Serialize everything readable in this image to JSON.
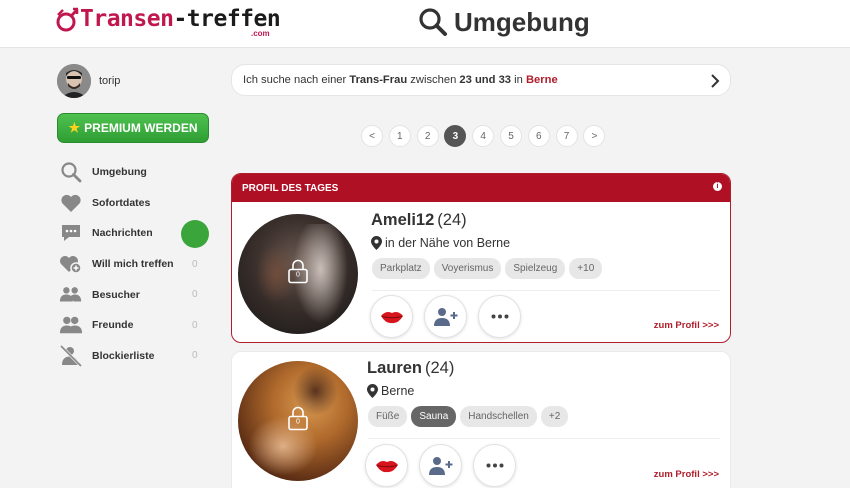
{
  "header": {
    "logo_main": "Transen",
    "logo_second": "-treffen",
    "logo_suffix": ".com",
    "title": "Umgebung",
    "title_icon": "search-icon"
  },
  "sidebar": {
    "username": "torip",
    "premium_label": "PREMIUM WERDEN",
    "items": [
      {
        "label": "Umgebung",
        "icon": "search-icon",
        "count": ""
      },
      {
        "label": "Sofortdates",
        "icon": "heart-icon",
        "count": ""
      },
      {
        "label": "Nachrichten",
        "icon": "chat-icon",
        "count": ""
      },
      {
        "label": "Will mich treffen",
        "icon": "heart-plus-icon",
        "count": "0"
      },
      {
        "label": "Besucher",
        "icon": "visitors-icon",
        "count": "0"
      },
      {
        "label": "Freunde",
        "icon": "friends-icon",
        "count": "0"
      },
      {
        "label": "Blockierliste",
        "icon": "blocked-user-icon",
        "count": "0"
      }
    ]
  },
  "search": {
    "prefix": "Ich suche nach einer",
    "gender": "Trans-Frau",
    "between": "zwischen",
    "ages": "23 und 33",
    "in": "in",
    "city": "Berne"
  },
  "pagination": {
    "prev": "<",
    "next": ">",
    "pages": [
      "1",
      "2",
      "3",
      "4",
      "5",
      "6",
      "7"
    ],
    "current": "3"
  },
  "profiles": [
    {
      "badge": "PROFIL DES TAGES",
      "name": "Ameli12",
      "age": "(24)",
      "location": "in der Nähe von Berne",
      "photo_count": "0",
      "tags": [
        {
          "label": "Parkplatz",
          "active": false
        },
        {
          "label": "Voyerismus",
          "active": false
        },
        {
          "label": "Spielzeug",
          "active": false
        },
        {
          "label": "+10",
          "active": false
        }
      ],
      "link": "zum Profil >>>"
    },
    {
      "badge": "",
      "name": "Lauren",
      "age": "(24)",
      "location": "Berne",
      "photo_count": "0",
      "tags": [
        {
          "label": "Füße",
          "active": false
        },
        {
          "label": "Sauna",
          "active": true
        },
        {
          "label": "Handschellen",
          "active": false
        },
        {
          "label": "+2",
          "active": false
        }
      ],
      "link": "zum Profil >>>"
    }
  ],
  "colors": {
    "brand": "#c0184e",
    "accent_red": "#b01024",
    "premium_green": "#3aa53b",
    "active_page": "#555555"
  }
}
